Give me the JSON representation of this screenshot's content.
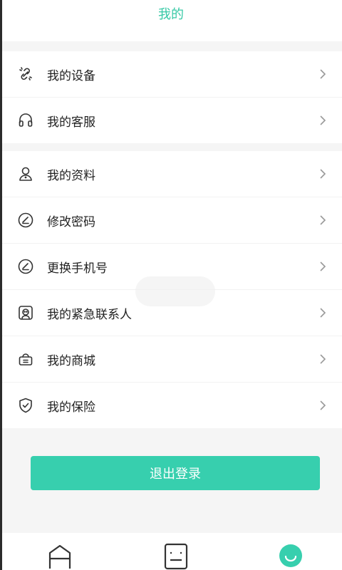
{
  "header": {
    "title": "我的"
  },
  "groups": [
    {
      "items": [
        {
          "label": "我的设备",
          "icon": "device-link-icon"
        },
        {
          "label": "我的客服",
          "icon": "headset-icon"
        }
      ]
    },
    {
      "items": [
        {
          "label": "我的资料",
          "icon": "profile-icon"
        },
        {
          "label": "修改密码",
          "icon": "edit-circle-icon"
        },
        {
          "label": "更换手机号",
          "icon": "edit-circle-icon"
        },
        {
          "label": "我的紧急联系人",
          "icon": "emergency-contact-icon"
        },
        {
          "label": "我的商城",
          "icon": "shop-basket-icon"
        },
        {
          "label": "我的保险",
          "icon": "shield-check-icon"
        }
      ]
    }
  ],
  "logout": {
    "label": "退出登录"
  },
  "tabbar": {
    "items": [
      {
        "icon": "home-icon",
        "active": false
      },
      {
        "icon": "list-icon",
        "active": false
      },
      {
        "icon": "me-icon",
        "active": true
      }
    ]
  },
  "colors": {
    "accent": "#37c9a6",
    "button": "#37cfae",
    "background": "#f5f5f5"
  }
}
